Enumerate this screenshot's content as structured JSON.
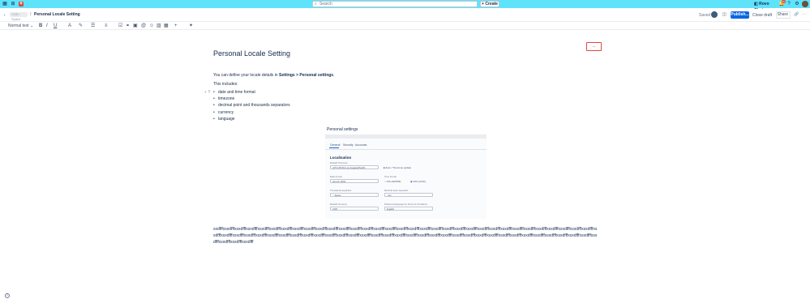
{
  "topbar": {
    "search_placeholder": "Search",
    "create_label": "Create",
    "rovo_label": "Rovo Chat",
    "notification_count": "9+"
  },
  "breadcrumb": {
    "space": "CNS / Space",
    "page": "Personal Locale Setting"
  },
  "header": {
    "saved_label": "Saved",
    "publish_label": "Publish...",
    "close_draft_label": "Close draft",
    "share_label": "Share"
  },
  "toolbar": {
    "text_style": "Normal text"
  },
  "page": {
    "title": "Personal Locale Setting",
    "intro_prefix": "You can define your locale details in ",
    "intro_bold": "Settings > Personal settings",
    "intro_suffix": ".",
    "includes": "This includes:",
    "bullets": [
      "date and time format",
      "timezone",
      "decimal point and thousands separators",
      "currency",
      "language"
    ],
    "image_caption": "Personal settings",
    "long_text": "sxdfffxsxdfffxsxdfffxsxdfffxsxdfffxsxdfffxsxdfffxsxdfffxsxdfffxsxdfffxsxdfffxsxdfffxsxdfffxsxdfffxsxdfffxsxdfffxsxdfffxsxdfffxsxdfffxsxdfffxsxdfffxsxdfffxsxdfffxsxdfffxsxdfffxsxdfffxsxdfffxsxdfffxsxdfffxsxdfffxsxdfffxsxdfffxsxdfffxsxdfffxsxdfffxsxdfffxsxdfffxsxdfffxsxdfffxsxdfffxsxdfffxsxdfffxsxdfffxsxdfffxsxdfffxsxdfffxsxdfffxsxdfffxsxdfffxsxdfffxsxdfffxsxdfffxsxdfffxsxdfffxsxdfffxsxdfffxsxdfffxsxdfffxsxdfffxsxdfffxsxdfffxsxdfffxsxdfffxsxdfffxsxdfffxsxdfffxsxdfffxsxdfffxsxdfffxsxdfff"
  },
  "embed": {
    "tabs": [
      "General",
      "Security",
      "Accounts"
    ],
    "section": "Localisation",
    "default_timezone_label": "Default Timezone",
    "default_timezone_value": "(UTC-08:00) Los Angeles/Pacific",
    "auto_tz_label": "Auto / Timezone update",
    "date_format_label": "Date format",
    "date_format_value": "Jan 23, 2019",
    "time_format_label": "Time format",
    "time_12h": "12h (AM/PM)",
    "time_24h": "24h (13:00)",
    "thousands_label": "Thousands separator",
    "thousands_value": "' ' Space",
    "decimal_label": "Decimal point separator",
    "decimal_value": ", dot",
    "currency_label": "Default Currency",
    "currency_value": "USD",
    "language_label": "Preferred language for Terms & Conditions",
    "language_value": "English"
  },
  "colors": {
    "topbar": "#5fe3fb",
    "primary": "#0c66e4",
    "highlight": "#e2483d"
  }
}
